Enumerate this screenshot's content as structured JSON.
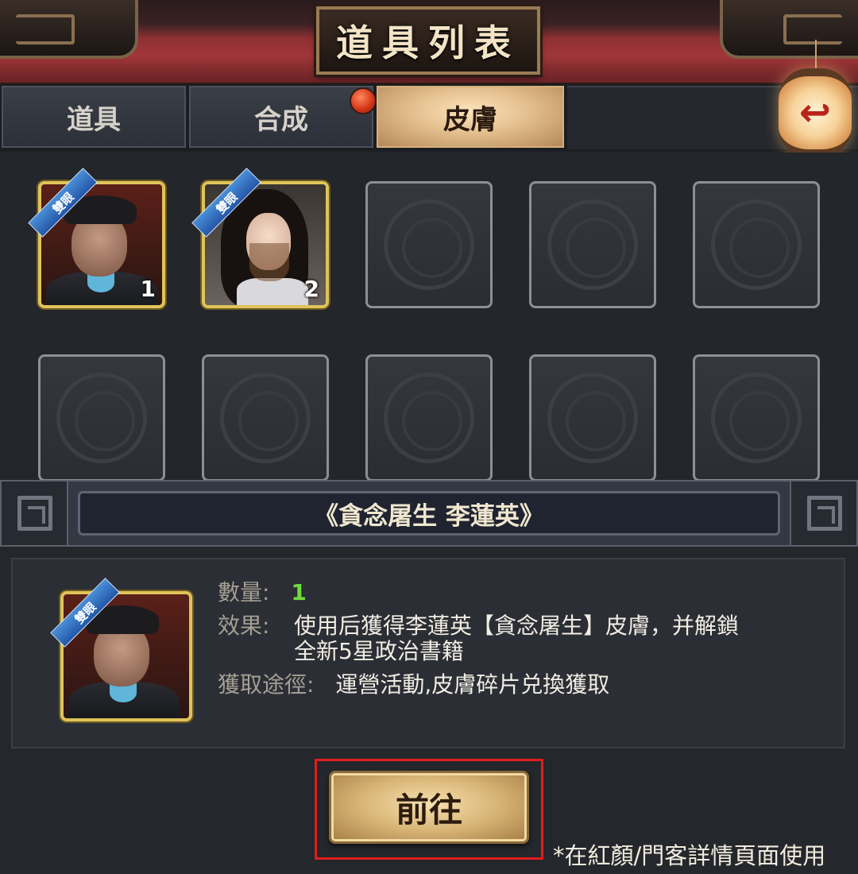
{
  "header": {
    "title": "道具列表"
  },
  "tabs": [
    {
      "label": "道具",
      "active": false
    },
    {
      "label": "合成",
      "active": false,
      "badge": true
    },
    {
      "label": "皮膚",
      "active": true
    }
  ],
  "back_icon": "back-arrow-icon",
  "lantern_glyph": "↩",
  "grid": {
    "slots": [
      {
        "filled": true,
        "tag": "雙眼",
        "count": "1",
        "portrait": "eunuch-portrait"
      },
      {
        "filled": true,
        "tag": "雙眼",
        "count": "2",
        "portrait": "veiled-lady-portrait"
      },
      {
        "filled": false
      },
      {
        "filled": false
      },
      {
        "filled": false
      },
      {
        "filled": false
      },
      {
        "filled": false
      },
      {
        "filled": false
      },
      {
        "filled": false
      },
      {
        "filled": false
      }
    ]
  },
  "selected": {
    "name": "《貪念屠生 李蓮英》",
    "tag": "雙眼",
    "quantity_label": "數量:",
    "quantity": "1",
    "effect_label": "效果:",
    "effect_line1": "使用后獲得李蓮英【貪念屠生】皮膚，并解鎖",
    "effect_line2": "全新5星政治書籍",
    "source_label": "獲取途徑:",
    "source": "運營活動,皮膚碎片兑換獲取"
  },
  "go_button": {
    "label": "前往"
  },
  "note": "*在紅顏/門客詳情頁面使用",
  "colors": {
    "accent_gold": "#e0c35a",
    "highlight_red": "#e21d1d",
    "quantity_green": "#6fdc3c"
  }
}
